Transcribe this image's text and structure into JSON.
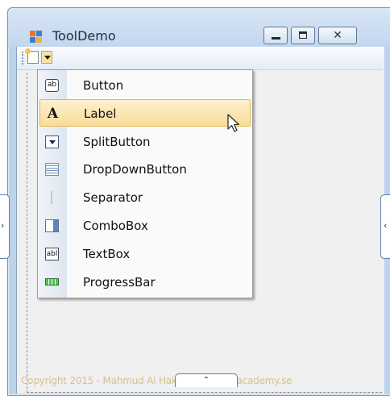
{
  "window": {
    "title": "ToolDemo",
    "controls": {
      "minimize": "minimize",
      "maximize": "maximize",
      "close": "✕"
    }
  },
  "toolbar": {
    "add_item_icon": "new-item-icon",
    "dropdown_icon": "chevron-down-icon"
  },
  "menu": {
    "items": [
      {
        "label": "Button",
        "icon": "button-icon"
      },
      {
        "label": "Label",
        "icon": "label-icon",
        "highlighted": true
      },
      {
        "label": "SplitButton",
        "icon": "split-button-icon"
      },
      {
        "label": "DropDownButton",
        "icon": "dropdown-button-icon"
      },
      {
        "label": "Separator",
        "icon": "separator-icon"
      },
      {
        "label": "ComboBox",
        "icon": "combobox-icon"
      },
      {
        "label": "TextBox",
        "icon": "textbox-icon"
      },
      {
        "label": "ProgressBar",
        "icon": "progressbar-icon"
      }
    ]
  },
  "icon_text": {
    "button": "ab",
    "label": "A",
    "textbox": "abl"
  },
  "handles": {
    "left": "›",
    "right": "‹",
    "bottom": "⌃"
  },
  "watermark": "Copyright 2015 - Mahmud Al Hakim www.webacademy.se",
  "colors": {
    "highlight": "#f8dc97",
    "window_frame": "#bcd3ec",
    "watermark": "#d6c08e"
  }
}
